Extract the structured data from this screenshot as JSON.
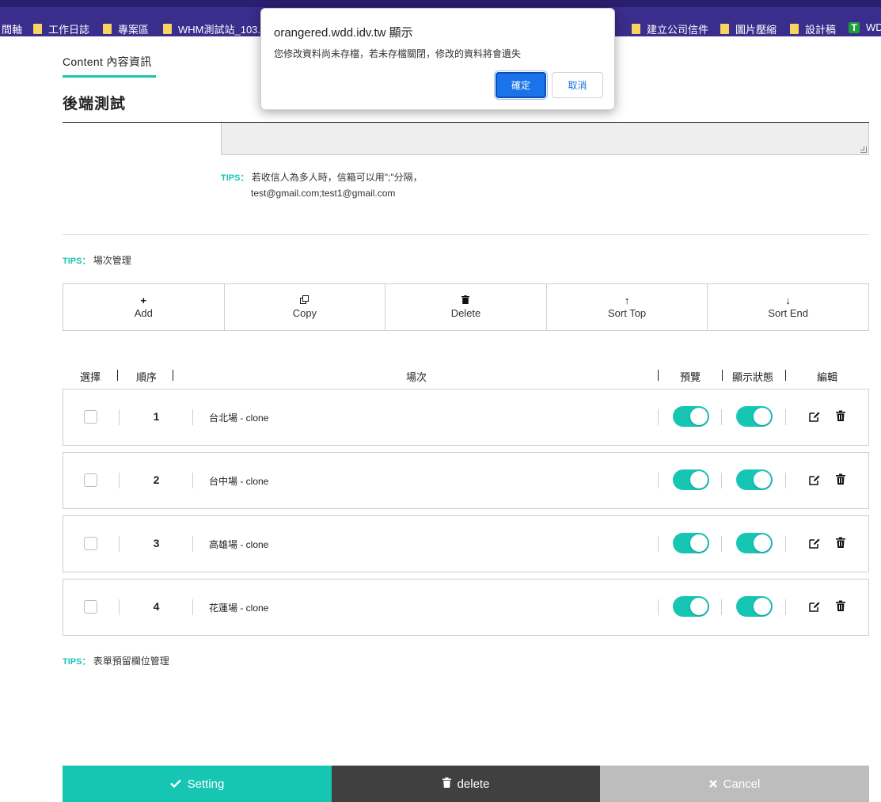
{
  "bookmarks": [
    {
      "label": "間軸",
      "icon": "none"
    },
    {
      "label": "工作日誌",
      "icon": "folder-icon"
    },
    {
      "label": "專案區",
      "icon": "folder-icon"
    },
    {
      "label": "WHM測試站_103...",
      "icon": "folder-icon"
    },
    {
      "label": "建立公司信件",
      "icon": "folder-icon"
    },
    {
      "label": "圖片壓縮",
      "icon": "folder-icon"
    },
    {
      "label": "設計稿",
      "icon": "folder-icon"
    },
    {
      "label": "WD",
      "icon": "green-t-icon"
    }
  ],
  "page": {
    "tab_label": "Content 內容資訊",
    "title": "後端測試",
    "tips_key": "TIPS：",
    "tips1_line1": "若收信人為多人時，信箱可以用\";\"分隔，",
    "tips1_line2": "test@gmail.com;test1@gmail.com",
    "tips2": "場次管理",
    "tips3": "表單預留欄位管理"
  },
  "toolbar": [
    {
      "label": "Add",
      "icon": "plus-icon",
      "glyph": "+"
    },
    {
      "label": "Copy",
      "icon": "copy-icon",
      "glyph": "⧉"
    },
    {
      "label": "Delete",
      "icon": "trash-icon",
      "glyph": "🗑"
    },
    {
      "label": "Sort Top",
      "icon": "arrow-up-icon",
      "glyph": "↑"
    },
    {
      "label": "Sort End",
      "icon": "arrow-down-icon",
      "glyph": "↓"
    }
  ],
  "table": {
    "headers": {
      "select": "選擇",
      "order": "順序",
      "session": "場次",
      "preview": "預覽",
      "status": "顯示狀態",
      "edit": "編輯"
    },
    "rows": [
      {
        "order": "1",
        "name": "台北場 - clone",
        "preview": true,
        "status": true,
        "checked": false
      },
      {
        "order": "2",
        "name": "台中場 - clone",
        "preview": true,
        "status": true,
        "checked": false
      },
      {
        "order": "3",
        "name": "高雄場 - clone",
        "preview": true,
        "status": true,
        "checked": false
      },
      {
        "order": "4",
        "name": "花蓮場 - clone",
        "preview": true,
        "status": true,
        "checked": false
      }
    ]
  },
  "bottom": {
    "setting": "Setting",
    "delete": "delete",
    "cancel": "Cancel"
  },
  "dialog": {
    "title": "orangered.wdd.idv.tw 顯示",
    "message": "您修改資料尚未存檔，若未存檔關閉，修改的資料將會遺失",
    "ok": "確定",
    "cancel": "取消"
  },
  "colors": {
    "accent": "#17c5b3",
    "bookmark_bar": "#3a2d8c",
    "delete_bar": "#404040",
    "cancel_bar": "#bdbdbd",
    "dialog_ok": "#1a73e8"
  }
}
